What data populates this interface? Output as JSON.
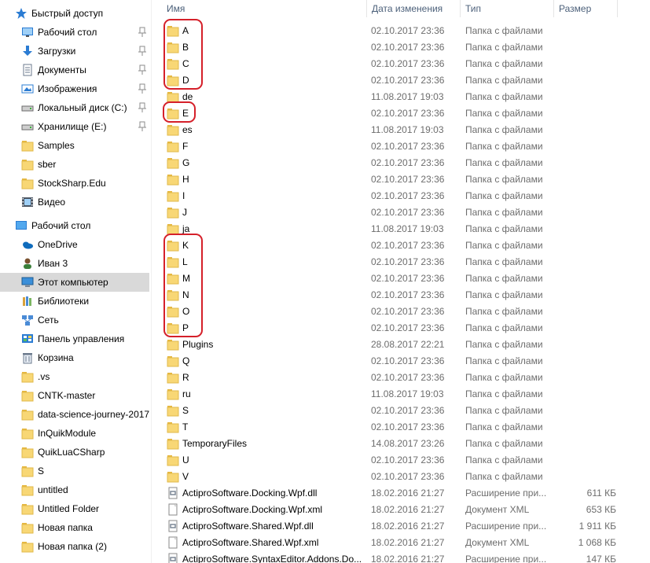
{
  "nav": {
    "items": [
      {
        "label": "Быстрый доступ",
        "icon": "star-icon",
        "level": 0,
        "pinned": false,
        "selected": false
      },
      {
        "label": "Рабочий стол",
        "icon": "desktop-icon",
        "level": 1,
        "pinned": true,
        "selected": false
      },
      {
        "label": "Загрузки",
        "icon": "downloads-icon",
        "level": 1,
        "pinned": true,
        "selected": false
      },
      {
        "label": "Документы",
        "icon": "documents-icon",
        "level": 1,
        "pinned": true,
        "selected": false
      },
      {
        "label": "Изображения",
        "icon": "pictures-icon",
        "level": 1,
        "pinned": true,
        "selected": false
      },
      {
        "label": "Локальный диск (C:)",
        "icon": "drive-icon",
        "level": 1,
        "pinned": true,
        "selected": false
      },
      {
        "label": "Хранилище (E:)",
        "icon": "drive-icon",
        "level": 1,
        "pinned": true,
        "selected": false
      },
      {
        "label": "Samples",
        "icon": "folder-icon",
        "level": 1,
        "pinned": false,
        "selected": false
      },
      {
        "label": "sber",
        "icon": "folder-icon",
        "level": 1,
        "pinned": false,
        "selected": false
      },
      {
        "label": "StockSharp.Edu",
        "icon": "folder-icon",
        "level": 1,
        "pinned": false,
        "selected": false
      },
      {
        "label": "Видео",
        "icon": "video-icon",
        "level": 1,
        "pinned": false,
        "selected": false
      },
      {
        "label": "Рабочий стол",
        "icon": "desktop-blue-icon",
        "level": 0,
        "pinned": false,
        "selected": false
      },
      {
        "label": "OneDrive",
        "icon": "onedrive-icon",
        "level": 1,
        "pinned": false,
        "selected": false
      },
      {
        "label": "Иван 3",
        "icon": "user-icon",
        "level": 1,
        "pinned": false,
        "selected": false
      },
      {
        "label": "Этот компьютер",
        "icon": "computer-icon",
        "level": 1,
        "pinned": false,
        "selected": true
      },
      {
        "label": "Библиотеки",
        "icon": "libraries-icon",
        "level": 1,
        "pinned": false,
        "selected": false
      },
      {
        "label": "Сеть",
        "icon": "network-icon",
        "level": 1,
        "pinned": false,
        "selected": false
      },
      {
        "label": "Панель управления",
        "icon": "control-panel-icon",
        "level": 1,
        "pinned": false,
        "selected": false
      },
      {
        "label": "Корзина",
        "icon": "recycle-bin-icon",
        "level": 1,
        "pinned": false,
        "selected": false
      },
      {
        "label": ".vs",
        "icon": "folder-icon",
        "level": 1,
        "pinned": false,
        "selected": false
      },
      {
        "label": "CNTK-master",
        "icon": "folder-icon",
        "level": 1,
        "pinned": false,
        "selected": false
      },
      {
        "label": "data-science-journey-2017",
        "icon": "folder-icon",
        "level": 1,
        "pinned": false,
        "selected": false
      },
      {
        "label": "InQuikModule",
        "icon": "folder-icon",
        "level": 1,
        "pinned": false,
        "selected": false
      },
      {
        "label": "QuikLuaCSharp",
        "icon": "folder-icon",
        "level": 1,
        "pinned": false,
        "selected": false
      },
      {
        "label": "S",
        "icon": "folder-icon",
        "level": 1,
        "pinned": false,
        "selected": false
      },
      {
        "label": "untitled",
        "icon": "folder-icon",
        "level": 1,
        "pinned": false,
        "selected": false
      },
      {
        "label": "Untitled Folder",
        "icon": "folder-icon",
        "level": 1,
        "pinned": false,
        "selected": false
      },
      {
        "label": "Новая папка",
        "icon": "folder-icon",
        "level": 1,
        "pinned": false,
        "selected": false
      },
      {
        "label": "Новая папка (2)",
        "icon": "folder-icon",
        "level": 1,
        "pinned": false,
        "selected": false
      }
    ]
  },
  "columns": {
    "name": "Имя",
    "date": "Дата изменения",
    "type": "Тип",
    "size": "Размер"
  },
  "files": [
    {
      "name": "A",
      "date": "02.10.2017 23:36",
      "type": "Папка с файлами",
      "size": "",
      "icon": "folder-icon"
    },
    {
      "name": "B",
      "date": "02.10.2017 23:36",
      "type": "Папка с файлами",
      "size": "",
      "icon": "folder-icon"
    },
    {
      "name": "C",
      "date": "02.10.2017 23:36",
      "type": "Папка с файлами",
      "size": "",
      "icon": "folder-icon"
    },
    {
      "name": "D",
      "date": "02.10.2017 23:36",
      "type": "Папка с файлами",
      "size": "",
      "icon": "folder-icon"
    },
    {
      "name": "de",
      "date": "11.08.2017 19:03",
      "type": "Папка с файлами",
      "size": "",
      "icon": "folder-icon"
    },
    {
      "name": "E",
      "date": "02.10.2017 23:36",
      "type": "Папка с файлами",
      "size": "",
      "icon": "folder-icon"
    },
    {
      "name": "es",
      "date": "11.08.2017 19:03",
      "type": "Папка с файлами",
      "size": "",
      "icon": "folder-icon"
    },
    {
      "name": "F",
      "date": "02.10.2017 23:36",
      "type": "Папка с файлами",
      "size": "",
      "icon": "folder-icon"
    },
    {
      "name": "G",
      "date": "02.10.2017 23:36",
      "type": "Папка с файлами",
      "size": "",
      "icon": "folder-icon"
    },
    {
      "name": "H",
      "date": "02.10.2017 23:36",
      "type": "Папка с файлами",
      "size": "",
      "icon": "folder-icon"
    },
    {
      "name": "I",
      "date": "02.10.2017 23:36",
      "type": "Папка с файлами",
      "size": "",
      "icon": "folder-icon"
    },
    {
      "name": "J",
      "date": "02.10.2017 23:36",
      "type": "Папка с файлами",
      "size": "",
      "icon": "folder-icon"
    },
    {
      "name": "ja",
      "date": "11.08.2017 19:03",
      "type": "Папка с файлами",
      "size": "",
      "icon": "folder-icon"
    },
    {
      "name": "K",
      "date": "02.10.2017 23:36",
      "type": "Папка с файлами",
      "size": "",
      "icon": "folder-icon"
    },
    {
      "name": "L",
      "date": "02.10.2017 23:36",
      "type": "Папка с файлами",
      "size": "",
      "icon": "folder-icon"
    },
    {
      "name": "M",
      "date": "02.10.2017 23:36",
      "type": "Папка с файлами",
      "size": "",
      "icon": "folder-icon"
    },
    {
      "name": "N",
      "date": "02.10.2017 23:36",
      "type": "Папка с файлами",
      "size": "",
      "icon": "folder-icon"
    },
    {
      "name": "O",
      "date": "02.10.2017 23:36",
      "type": "Папка с файлами",
      "size": "",
      "icon": "folder-icon"
    },
    {
      "name": "P",
      "date": "02.10.2017 23:36",
      "type": "Папка с файлами",
      "size": "",
      "icon": "folder-icon"
    },
    {
      "name": "Plugins",
      "date": "28.08.2017 22:21",
      "type": "Папка с файлами",
      "size": "",
      "icon": "folder-icon"
    },
    {
      "name": "Q",
      "date": "02.10.2017 23:36",
      "type": "Папка с файлами",
      "size": "",
      "icon": "folder-icon"
    },
    {
      "name": "R",
      "date": "02.10.2017 23:36",
      "type": "Папка с файлами",
      "size": "",
      "icon": "folder-icon"
    },
    {
      "name": "ru",
      "date": "11.08.2017 19:03",
      "type": "Папка с файлами",
      "size": "",
      "icon": "folder-icon"
    },
    {
      "name": "S",
      "date": "02.10.2017 23:36",
      "type": "Папка с файлами",
      "size": "",
      "icon": "folder-icon"
    },
    {
      "name": "T",
      "date": "02.10.2017 23:36",
      "type": "Папка с файлами",
      "size": "",
      "icon": "folder-icon"
    },
    {
      "name": "TemporaryFiles",
      "date": "14.08.2017 23:26",
      "type": "Папка с файлами",
      "size": "",
      "icon": "folder-icon"
    },
    {
      "name": "U",
      "date": "02.10.2017 23:36",
      "type": "Папка с файлами",
      "size": "",
      "icon": "folder-icon"
    },
    {
      "name": "V",
      "date": "02.10.2017 23:36",
      "type": "Папка с файлами",
      "size": "",
      "icon": "folder-icon"
    },
    {
      "name": "ActiproSoftware.Docking.Wpf.dll",
      "date": "18.02.2016 21:27",
      "type": "Расширение при...",
      "size": "611 КБ",
      "icon": "dll-file-icon"
    },
    {
      "name": "ActiproSoftware.Docking.Wpf.xml",
      "date": "18.02.2016 21:27",
      "type": "Документ XML",
      "size": "653 КБ",
      "icon": "xml-file-icon"
    },
    {
      "name": "ActiproSoftware.Shared.Wpf.dll",
      "date": "18.02.2016 21:27",
      "type": "Расширение при...",
      "size": "1 911 КБ",
      "icon": "dll-file-icon"
    },
    {
      "name": "ActiproSoftware.Shared.Wpf.xml",
      "date": "18.02.2016 21:27",
      "type": "Документ XML",
      "size": "1 068 КБ",
      "icon": "xml-file-icon"
    },
    {
      "name": "ActiproSoftware.SyntaxEditor.Addons.Do...",
      "date": "18.02.2016 21:27",
      "type": "Расширение при...",
      "size": "147 КБ",
      "icon": "dll-file-icon"
    }
  ],
  "highlights": [
    {
      "from": "A",
      "to": "D"
    },
    {
      "from": "E",
      "to": "E"
    },
    {
      "from": "K",
      "to": "P"
    }
  ],
  "colors": {
    "selected_bg": "#d9d9d9",
    "header_text": "#4c607a",
    "meta_text": "#6d6d6d",
    "folder": "#f8d775",
    "highlight": "#d5202a"
  }
}
